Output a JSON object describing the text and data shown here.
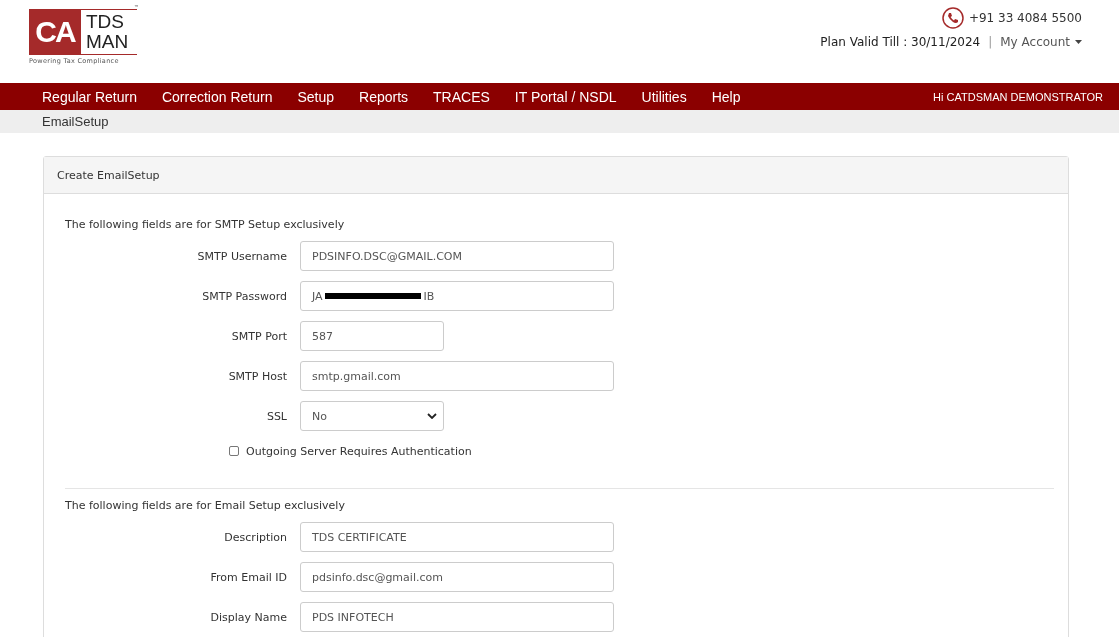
{
  "header": {
    "logo": {
      "mark": "CA",
      "line1": "TDS",
      "line2": "MAN",
      "tm": "™",
      "tagline": "Powering Tax Compliance"
    },
    "phone": "+91 33 4084 5500",
    "plan_valid": "Plan Valid Till : 30/11/2024",
    "separator": "|",
    "account_menu": "My Account"
  },
  "nav": {
    "items": [
      {
        "label": "Regular Return",
        "selected": false
      },
      {
        "label": "Correction Return",
        "selected": false
      },
      {
        "label": "Setup",
        "selected": false
      },
      {
        "label": "Reports",
        "selected": false
      },
      {
        "label": "TRACES",
        "selected": false
      },
      {
        "label": "IT Portal / NSDL",
        "selected": false
      },
      {
        "label": "Utilities",
        "selected": false
      },
      {
        "label": "Help",
        "selected": false
      }
    ],
    "greeting": "Hi CATDSMAN DEMONSTRATOR"
  },
  "breadcrumb": "EmailSetup",
  "panel": {
    "title": "Create EmailSetup",
    "sections": [
      {
        "note": "The following fields are for SMTP Setup exclusively",
        "fields": [
          {
            "kind": "text",
            "label": "SMTP Username",
            "value": "PDSINFO.DSC@GMAIL.COM"
          },
          {
            "kind": "redacted",
            "label": "SMTP Password",
            "value_start": "JA",
            "value_end": "IB"
          },
          {
            "kind": "short",
            "label": "SMTP Port",
            "value": "587"
          },
          {
            "kind": "text",
            "label": "SMTP Host",
            "value": "smtp.gmail.com"
          },
          {
            "kind": "select",
            "label": "SSL",
            "value": "No"
          },
          {
            "kind": "checkbox",
            "label": "Outgoing Server Requires Authentication",
            "checked": false
          }
        ]
      },
      {
        "note": "The following fields are for Email Setup exclusively",
        "fields": [
          {
            "kind": "text",
            "label": "Description",
            "value": "TDS CERTIFICATE"
          },
          {
            "kind": "text",
            "label": "From Email ID",
            "value": "pdsinfo.dsc@gmail.com"
          },
          {
            "kind": "text",
            "label": "Display Name",
            "value": "PDS INFOTECH"
          }
        ]
      }
    ]
  }
}
